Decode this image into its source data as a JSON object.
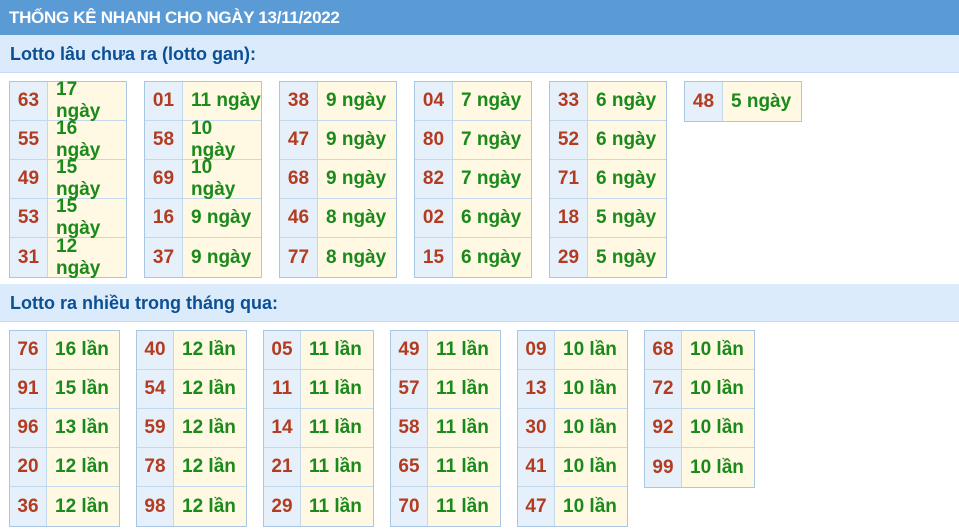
{
  "header": {
    "title": "THỐNG KÊ NHANH CHO NGÀY 13/11/2022"
  },
  "colors": {
    "header_bg": "#5b9bd5",
    "section_bg": "#dcebfb",
    "number": "#b33c20",
    "value": "#1a8a1a"
  },
  "gan": {
    "title": "Lotto lâu chưa ra (lotto gan):",
    "groups": [
      [
        {
          "n": "63",
          "v": "17 ngày"
        },
        {
          "n": "55",
          "v": "16 ngày"
        },
        {
          "n": "49",
          "v": "15 ngày"
        },
        {
          "n": "53",
          "v": "15 ngày"
        },
        {
          "n": "31",
          "v": "12 ngày"
        }
      ],
      [
        {
          "n": "01",
          "v": "11 ngày"
        },
        {
          "n": "58",
          "v": "10 ngày"
        },
        {
          "n": "69",
          "v": "10 ngày"
        },
        {
          "n": "16",
          "v": "9 ngày"
        },
        {
          "n": "37",
          "v": "9 ngày"
        }
      ],
      [
        {
          "n": "38",
          "v": "9 ngày"
        },
        {
          "n": "47",
          "v": "9 ngày"
        },
        {
          "n": "68",
          "v": "9 ngày"
        },
        {
          "n": "46",
          "v": "8 ngày"
        },
        {
          "n": "77",
          "v": "8 ngày"
        }
      ],
      [
        {
          "n": "04",
          "v": "7 ngày"
        },
        {
          "n": "80",
          "v": "7 ngày"
        },
        {
          "n": "82",
          "v": "7 ngày"
        },
        {
          "n": "02",
          "v": "6 ngày"
        },
        {
          "n": "15",
          "v": "6 ngày"
        }
      ],
      [
        {
          "n": "33",
          "v": "6 ngày"
        },
        {
          "n": "52",
          "v": "6 ngày"
        },
        {
          "n": "71",
          "v": "6 ngày"
        },
        {
          "n": "18",
          "v": "5 ngày"
        },
        {
          "n": "29",
          "v": "5 ngày"
        }
      ],
      [
        {
          "n": "48",
          "v": "5 ngày"
        }
      ]
    ]
  },
  "nhieu": {
    "title": "Lotto ra nhiều trong tháng qua:",
    "groups": [
      [
        {
          "n": "76",
          "v": "16 lần"
        },
        {
          "n": "91",
          "v": "15 lần"
        },
        {
          "n": "96",
          "v": "13 lần"
        },
        {
          "n": "20",
          "v": "12 lần"
        },
        {
          "n": "36",
          "v": "12 lần"
        }
      ],
      [
        {
          "n": "40",
          "v": "12 lần"
        },
        {
          "n": "54",
          "v": "12 lần"
        },
        {
          "n": "59",
          "v": "12 lần"
        },
        {
          "n": "78",
          "v": "12 lần"
        },
        {
          "n": "98",
          "v": "12 lần"
        }
      ],
      [
        {
          "n": "05",
          "v": "11 lần"
        },
        {
          "n": "11",
          "v": "11 lần"
        },
        {
          "n": "14",
          "v": "11 lần"
        },
        {
          "n": "21",
          "v": "11 lần"
        },
        {
          "n": "29",
          "v": "11 lần"
        }
      ],
      [
        {
          "n": "49",
          "v": "11 lần"
        },
        {
          "n": "57",
          "v": "11 lần"
        },
        {
          "n": "58",
          "v": "11 lần"
        },
        {
          "n": "65",
          "v": "11 lần"
        },
        {
          "n": "70",
          "v": "11 lần"
        }
      ],
      [
        {
          "n": "09",
          "v": "10 lần"
        },
        {
          "n": "13",
          "v": "10 lần"
        },
        {
          "n": "30",
          "v": "10 lần"
        },
        {
          "n": "41",
          "v": "10 lần"
        },
        {
          "n": "47",
          "v": "10 lần"
        }
      ],
      [
        {
          "n": "68",
          "v": "10 lần"
        },
        {
          "n": "72",
          "v": "10 lần"
        },
        {
          "n": "92",
          "v": "10 lần"
        },
        {
          "n": "99",
          "v": "10 lần"
        }
      ]
    ]
  }
}
